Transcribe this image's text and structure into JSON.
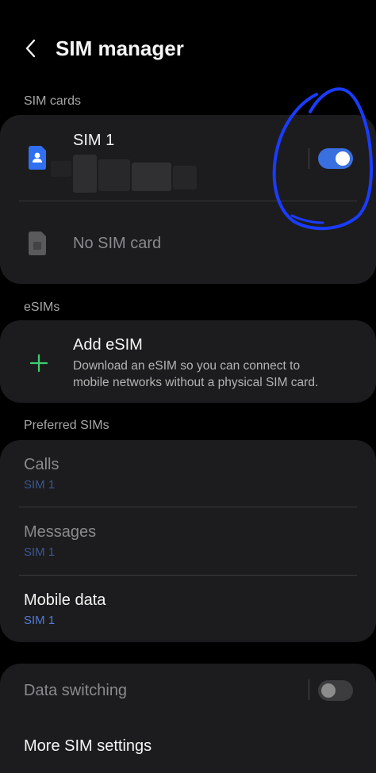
{
  "header": {
    "title": "SIM manager"
  },
  "sections": {
    "sim_cards": "SIM cards",
    "esims": "eSIMs",
    "preferred": "Preferred SIMs"
  },
  "sim_cards": {
    "sim1": {
      "label": "SIM 1",
      "enabled": true
    },
    "sim2": {
      "label": "No SIM card"
    }
  },
  "esim": {
    "title": "Add eSIM",
    "desc_line1": "Download an eSIM so you can connect to",
    "desc_line2": "mobile networks without a physical SIM card."
  },
  "preferred": {
    "calls": {
      "label": "Calls",
      "value": "SIM 1"
    },
    "messages": {
      "label": "Messages",
      "value": "SIM 1"
    },
    "mobile_data": {
      "label": "Mobile data",
      "value": "SIM 1"
    }
  },
  "bottom": {
    "data_switching": {
      "label": "Data switching",
      "enabled": false
    },
    "more_settings": "More SIM settings"
  },
  "colors": {
    "accent": "#3a6fe0",
    "annotation_circle": "#1a3cff",
    "esim_plus": "#3ecf6e"
  }
}
